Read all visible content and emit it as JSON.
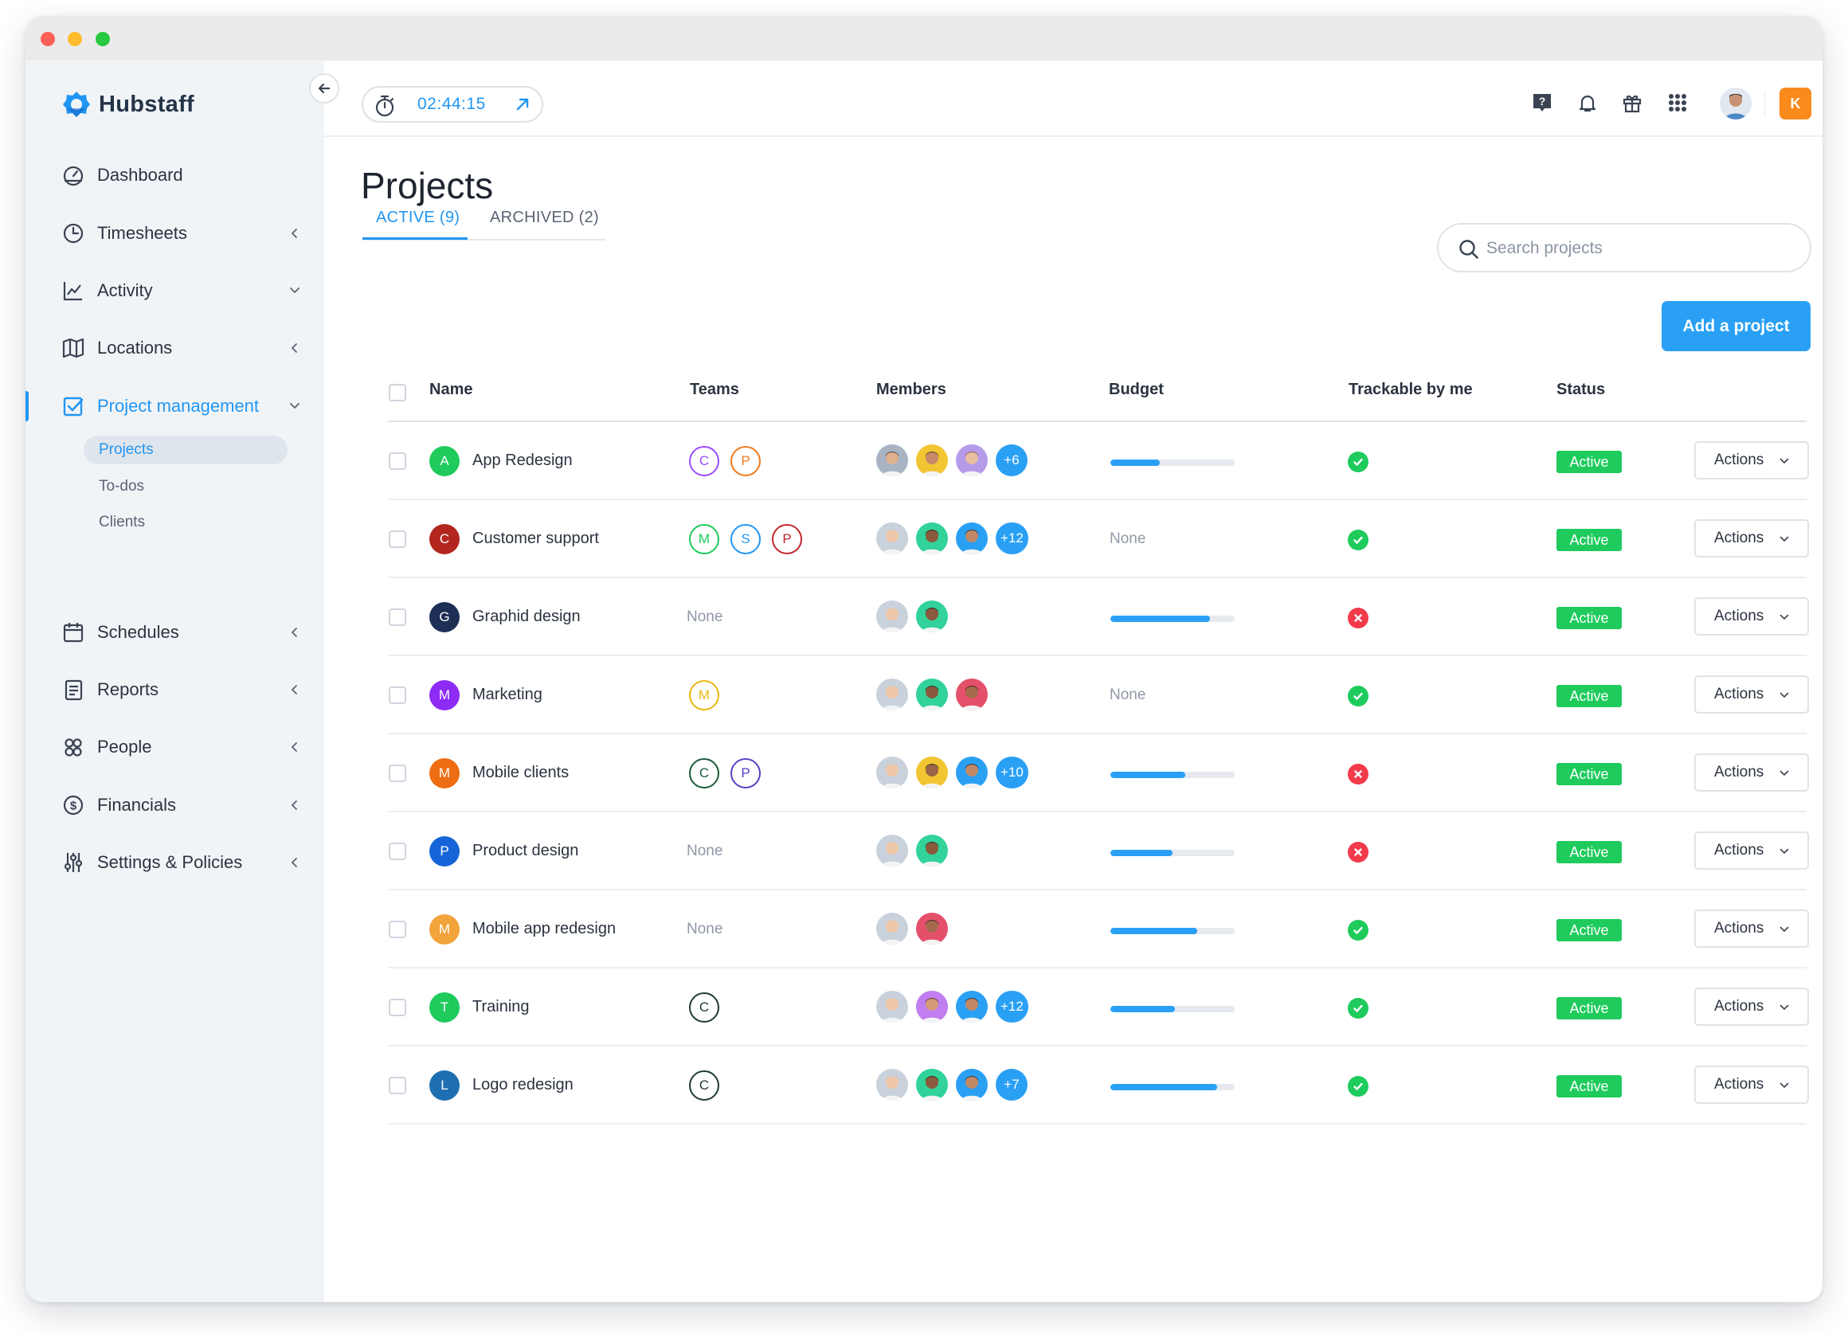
{
  "app": {
    "name": "Hubstaff"
  },
  "sidebar": {
    "items": [
      {
        "label": "Dashboard",
        "icon": "dashboard-icon",
        "chevron": "none"
      },
      {
        "label": "Timesheets",
        "icon": "clock-icon",
        "chevron": "left"
      },
      {
        "label": "Activity",
        "icon": "activity-chart-icon",
        "chevron": "down"
      },
      {
        "label": "Locations",
        "icon": "map-icon",
        "chevron": "left"
      },
      {
        "label": "Project management",
        "icon": "checkbox-icon",
        "chevron": "down",
        "active": true
      },
      {
        "label": "Schedules",
        "icon": "calendar-icon",
        "chevron": "left"
      },
      {
        "label": "Reports",
        "icon": "report-icon",
        "chevron": "left"
      },
      {
        "label": "People",
        "icon": "people-icon",
        "chevron": "left"
      },
      {
        "label": "Financials",
        "icon": "dollar-icon",
        "chevron": "left"
      },
      {
        "label": "Settings & Policies",
        "icon": "sliders-icon",
        "chevron": "left"
      }
    ],
    "subitems": [
      {
        "label": "Projects",
        "selected": true
      },
      {
        "label": "To-dos"
      },
      {
        "label": "Clients"
      }
    ]
  },
  "topbar": {
    "timer": "02:44:15",
    "user_initial": "K"
  },
  "page": {
    "title": "Projects",
    "tabs": [
      {
        "label": "ACTIVE (9)",
        "active": true
      },
      {
        "label": "ARCHIVED (2)",
        "active": false
      }
    ],
    "search_placeholder": "Search projects",
    "add_button": "Add a project"
  },
  "table": {
    "headers": [
      "Name",
      "Teams",
      "Members",
      "Budget",
      "Trackable by me",
      "Status"
    ],
    "none_label": "None",
    "actions_label": "Actions",
    "rows": [
      {
        "initial": "A",
        "color": "#1ecb5c",
        "name": "App Redesign",
        "teams": [
          [
            "C",
            "#9b4dff"
          ],
          [
            "P",
            "#f07a1d"
          ]
        ],
        "members": [
          "m1",
          "m2",
          "m3"
        ],
        "more": "+6",
        "budget": 0.4,
        "trackable": true,
        "status": "Active"
      },
      {
        "initial": "C",
        "color": "#b3261e",
        "name": "Customer support",
        "teams": [
          [
            "M",
            "#1ecb5c"
          ],
          [
            "S",
            "#2196f3"
          ],
          [
            "P",
            "#c1262c"
          ]
        ],
        "members": [
          "m4",
          "m5",
          "m6"
        ],
        "more": "+12",
        "budget": null,
        "trackable": true,
        "status": "Active"
      },
      {
        "initial": "G",
        "color": "#1d2f55",
        "name": "Graphid design",
        "teams": [],
        "members": [
          "m4",
          "m5"
        ],
        "more": "",
        "budget": 0.8,
        "trackable": false,
        "status": "Active"
      },
      {
        "initial": "M",
        "color": "#8e2bf5",
        "name": "Marketing",
        "teams": [
          [
            "M",
            "#e8b90f"
          ]
        ],
        "members": [
          "m4",
          "m5",
          "m7"
        ],
        "more": "",
        "budget": null,
        "trackable": true,
        "status": "Active"
      },
      {
        "initial": "M",
        "color": "#ee6d13",
        "name": "Mobile clients",
        "teams": [
          [
            "C",
            "#1d5a3a"
          ],
          [
            "P",
            "#5b3fc4"
          ]
        ],
        "members": [
          "m4",
          "m8",
          "m6"
        ],
        "more": "+10",
        "budget": 0.6,
        "trackable": false,
        "status": "Active"
      },
      {
        "initial": "P",
        "color": "#1565d8",
        "name": "Product design",
        "teams": [],
        "members": [
          "m4",
          "m5"
        ],
        "more": "",
        "budget": 0.5,
        "trackable": false,
        "status": "Active"
      },
      {
        "initial": "M",
        "color": "#f2a33a",
        "name": "Mobile app redesign",
        "teams": [],
        "members": [
          "m4",
          "m7"
        ],
        "more": "",
        "budget": 0.7,
        "trackable": true,
        "status": "Active"
      },
      {
        "initial": "T",
        "color": "#1ecb5c",
        "name": "Training",
        "teams": [
          [
            "C",
            "#1d3d2a"
          ]
        ],
        "members": [
          "m4",
          "m9",
          "m6"
        ],
        "more": "+12",
        "budget": 0.52,
        "trackable": true,
        "status": "Active"
      },
      {
        "initial": "L",
        "color": "#1d6fb1",
        "name": "Logo redesign",
        "teams": [
          [
            "C",
            "#1d3d2a"
          ]
        ],
        "members": [
          "m4",
          "m5",
          "m6"
        ],
        "more": "+7",
        "budget": 0.86,
        "trackable": true,
        "status": "Active"
      }
    ]
  },
  "colors": {
    "accent": "#2196f3",
    "button": "#2aa0f5",
    "status_active": "#1ecb5c",
    "track_yes": "#1ecb5c",
    "track_no": "#f23a4b",
    "user_badge": "#fa8a1b"
  }
}
